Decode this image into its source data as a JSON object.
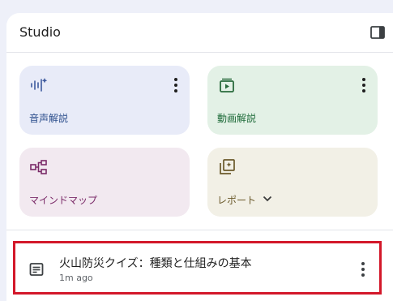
{
  "header": {
    "title": "Studio",
    "toggle_icon": "side-panel-icon"
  },
  "cards": [
    {
      "label": "音声解説",
      "icon": "audio-waveform-icon",
      "has_more": true,
      "color": "#2b4e8c"
    },
    {
      "label": "動画解説",
      "icon": "video-library-icon",
      "has_more": true,
      "color": "#1e6b39"
    },
    {
      "label": "マインドマップ",
      "icon": "mind-map-icon",
      "has_more": false,
      "color": "#7a2a68"
    },
    {
      "label": "レポート",
      "icon": "report-icon",
      "has_dropdown": true,
      "color": "#6b5a2b"
    }
  ],
  "notes": [
    {
      "title": "火山防災クイズ：種類と仕組みの基本",
      "time": "1m ago",
      "icon": "note-icon"
    }
  ],
  "colors": {
    "highlight_border": "#d3182a",
    "background": "#eef0f9"
  }
}
